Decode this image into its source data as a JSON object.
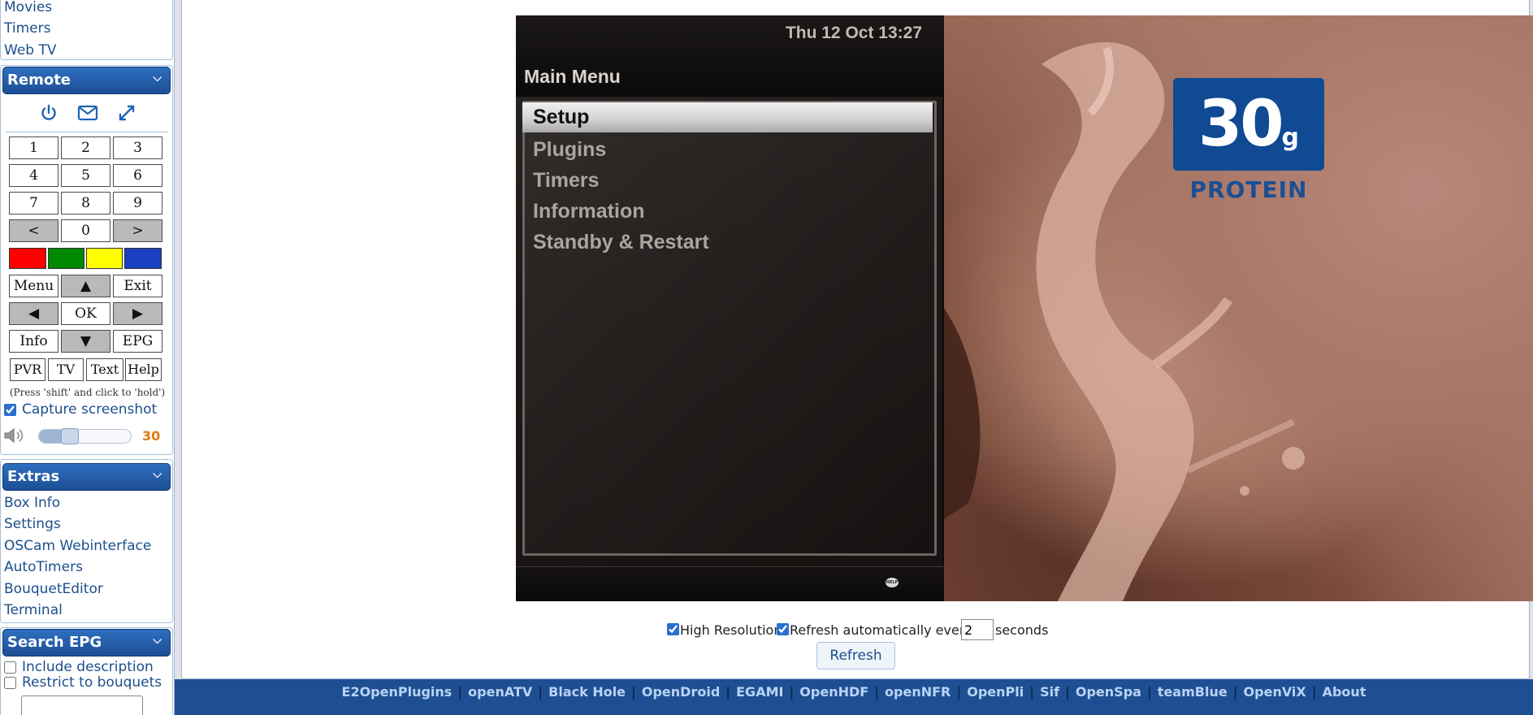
{
  "sidebar": {
    "top_links": [
      "Movies",
      "Timers",
      "Web TV"
    ],
    "remote": {
      "header": "Remote",
      "icons": [
        "power-icon",
        "mail-icon",
        "fullscreen-icon"
      ],
      "keys_digits": [
        "1",
        "2",
        "3",
        "4",
        "5",
        "6",
        "7",
        "8",
        "9"
      ],
      "key_prev": "<",
      "key_zero": "0",
      "key_next": ">",
      "color_keys": [
        "#ff0000",
        "#008800",
        "#ffff00",
        "#1a3fbf"
      ],
      "key_menu": "Menu",
      "key_up": "▲",
      "key_exit": "Exit",
      "key_left": "◀",
      "key_ok": "OK",
      "key_right": "▶",
      "key_info": "Info",
      "key_down": "▼",
      "key_epg": "EPG",
      "key_pvr": "PVR",
      "key_tv": "TV",
      "key_text": "Text",
      "key_help": "Help",
      "hint": "(Press 'shift' and click to 'hold')",
      "capture_label": "Capture screenshot",
      "capture_checked": true,
      "volume_value": "30",
      "volume_level": 0.3
    },
    "extras": {
      "header": "Extras",
      "links": [
        "Box Info",
        "Settings",
        "OSCam Webinterface",
        "AutoTimers",
        "BouquetEditor",
        "Terminal"
      ]
    },
    "search_epg": {
      "header": "Search EPG",
      "include_description": "Include description",
      "restrict_to_bouquets": "Restrict to bouquets"
    }
  },
  "tv_screen": {
    "clock": "Thu 12 Oct 13:27",
    "menu_title": "Main Menu",
    "menu_items": [
      "Setup",
      "Plugins",
      "Timers",
      "Information",
      "Standby & Restart"
    ],
    "selected_index": 0,
    "help_badge": "HELP",
    "ad_amount": "30",
    "ad_unit": "g",
    "ad_label": "PROTEIN"
  },
  "controls": {
    "high_resolution_label": "High Resolution",
    "high_resolution_checked": true,
    "refresh_auto_label": "Refresh automatically every",
    "refresh_auto_checked": true,
    "refresh_interval": "2",
    "seconds_label": "seconds",
    "refresh_button": "Refresh"
  },
  "footer": {
    "links": [
      "E2OpenPlugins",
      "openATV",
      "Black Hole",
      "OpenDroid",
      "EGAMI",
      "OpenHDF",
      "openNFR",
      "OpenPli",
      "Sif",
      "OpenSpa",
      "teamBlue",
      "OpenViX",
      "About"
    ]
  }
}
